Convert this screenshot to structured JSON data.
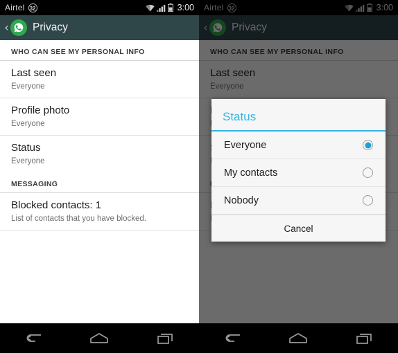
{
  "statusbar": {
    "carrier": "Airtel",
    "carrier_badge": "32",
    "clock": "3:00",
    "wifi_icon": "wifi-icon",
    "signal_icon": "signal-bars-icon",
    "battery_icon": "battery-icon"
  },
  "actionbar": {
    "back_caret": "‹",
    "app_icon": "whatsapp-logo-icon",
    "title": "Privacy"
  },
  "settings": {
    "sections": [
      {
        "header": "WHO CAN SEE MY PERSONAL INFO",
        "items": [
          {
            "title": "Last seen",
            "subtitle": "Everyone"
          },
          {
            "title": "Profile photo",
            "subtitle": "Everyone"
          },
          {
            "title": "Status",
            "subtitle": "Everyone"
          }
        ]
      },
      {
        "header": "MESSAGING",
        "items": [
          {
            "title": "Blocked contacts: 1",
            "subtitle": "List of contacts that you have blocked."
          }
        ]
      }
    ]
  },
  "dialog": {
    "title": "Status",
    "accent_color": "#33b5e5",
    "options": [
      {
        "label": "Everyone",
        "selected": true
      },
      {
        "label": "My contacts",
        "selected": false
      },
      {
        "label": "Nobody",
        "selected": false
      }
    ],
    "cancel_label": "Cancel"
  },
  "navbar": {
    "back": "back-icon",
    "home": "home-icon",
    "recents": "recent-apps-icon"
  }
}
